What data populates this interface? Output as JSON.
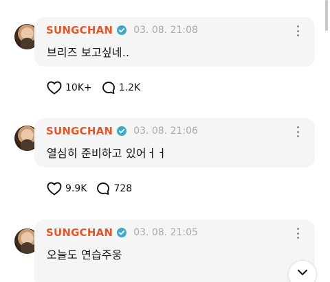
{
  "posts": [
    {
      "username": "SUNGCHAN",
      "timestamp": "03. 08. 21:08",
      "message": "브리즈 보고싶네..",
      "likes": "10K+",
      "comments": "1.2K"
    },
    {
      "username": "SUNGCHAN",
      "timestamp": "03. 08. 21:06",
      "message": "열심히 준비하고 있어ㅓㅓ",
      "likes": "9.9K",
      "comments": "728"
    },
    {
      "username": "SUNGCHAN",
      "timestamp": "03. 08. 21:05",
      "message": "오늘도 연습주웅"
    }
  ],
  "icons": {
    "verified": "verified-badge-icon",
    "more": "more-vertical-icon",
    "like": "heart-icon",
    "comment": "comment-icon",
    "scroll": "chevron-down-icon"
  },
  "colors": {
    "username": "#e2572a",
    "verified": "#3fa9c9",
    "bubble": "#f5f5f5",
    "timestamp": "#a9a9a9"
  }
}
